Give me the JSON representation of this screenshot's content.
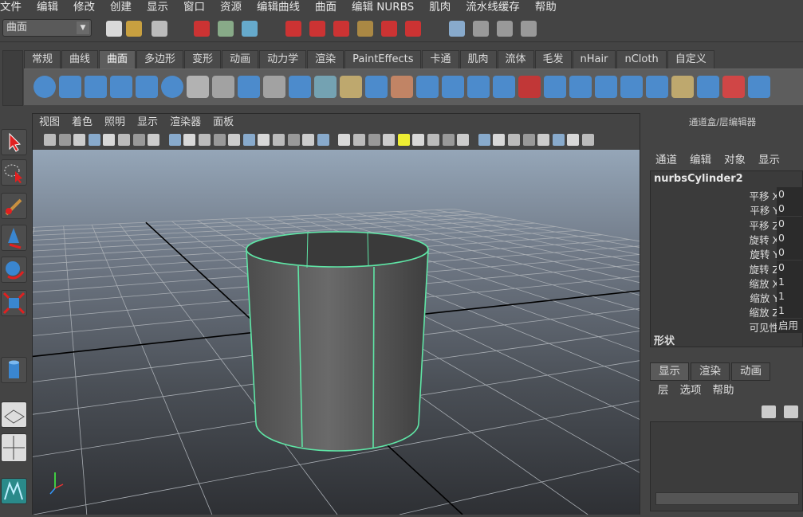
{
  "menubar": [
    "文件",
    "编辑",
    "修改",
    "创建",
    "显示",
    "窗口",
    "资源",
    "编辑曲线",
    "曲面",
    "编辑 NURBS",
    "肌肉",
    "流水线缓存",
    "帮助"
  ],
  "toolbar": {
    "mode_select": "曲面",
    "icons": [
      "new-scene-icon",
      "open-scene-icon",
      "save-scene-icon",
      "select-hierarchy-icon",
      "select-object-icon",
      "select-component-icon",
      "snap-grid-icon",
      "snap-curve-icon",
      "snap-point-icon",
      "snap-view-plane-icon",
      "snap-live-icon",
      "make-live-icon",
      "render-view-icon",
      "render-current-icon",
      "ipr-render-icon",
      "render-settings-icon"
    ]
  },
  "shelf": {
    "tabs": [
      "常规",
      "曲线",
      "曲面",
      "多边形",
      "变形",
      "动画",
      "动力学",
      "渲染",
      "PaintEffects",
      "卡通",
      "肌肉",
      "流体",
      "毛发",
      "nHair",
      "nCloth",
      "自定义"
    ],
    "active_tab": "曲面",
    "icons": [
      "nurbs-sphere-icon",
      "nurbs-cube-icon",
      "nurbs-cylinder-icon",
      "nurbs-cone-icon",
      "nurbs-plane-icon",
      "nurbs-torus-icon",
      "revolve-icon",
      "loft-icon",
      "planar-icon",
      "extrude-icon",
      "birail-icon",
      "boundary-icon",
      "square-icon",
      "bevel-icon",
      "project-curve-icon",
      "intersect-icon",
      "trim-icon",
      "untrim-icon",
      "attach-icon",
      "detach-icon",
      "align-icon",
      "open-close-icon",
      "insert-isoparm-icon",
      "extend-icon",
      "offset-icon",
      "rebuild-icon",
      "reverse-icon",
      "sculpt-icon",
      "stitch-icon"
    ]
  },
  "viewport": {
    "menu": [
      "视图",
      "着色",
      "照明",
      "显示",
      "渲染器",
      "面板"
    ],
    "object": "nurbsCylinder2",
    "wire_color": "#5fe6a6",
    "axis_labels": [
      "x",
      "y",
      "z"
    ]
  },
  "channel_box": {
    "title": "通道盒/层编辑器",
    "menu": [
      "通道",
      "编辑",
      "对象",
      "显示"
    ],
    "node": "nurbsCylinder2",
    "attributes": [
      {
        "label": "平移 X",
        "value": "0"
      },
      {
        "label": "平移 Y",
        "value": "0"
      },
      {
        "label": "平移 Z",
        "value": "0"
      },
      {
        "label": "旋转 X",
        "value": "0"
      },
      {
        "label": "旋转 Y",
        "value": "0"
      },
      {
        "label": "旋转 Z",
        "value": "0"
      },
      {
        "label": "缩放 X",
        "value": "1"
      },
      {
        "label": "缩放 Y",
        "value": "1"
      },
      {
        "label": "缩放 Z",
        "value": "1"
      },
      {
        "label": "可见性",
        "value": "启用"
      }
    ],
    "shape_label": "形状"
  },
  "layer_editor": {
    "tabs": [
      "显示",
      "渲染",
      "动画"
    ],
    "active_tab": "显示",
    "menu": [
      "层",
      "选项",
      "帮助"
    ]
  }
}
